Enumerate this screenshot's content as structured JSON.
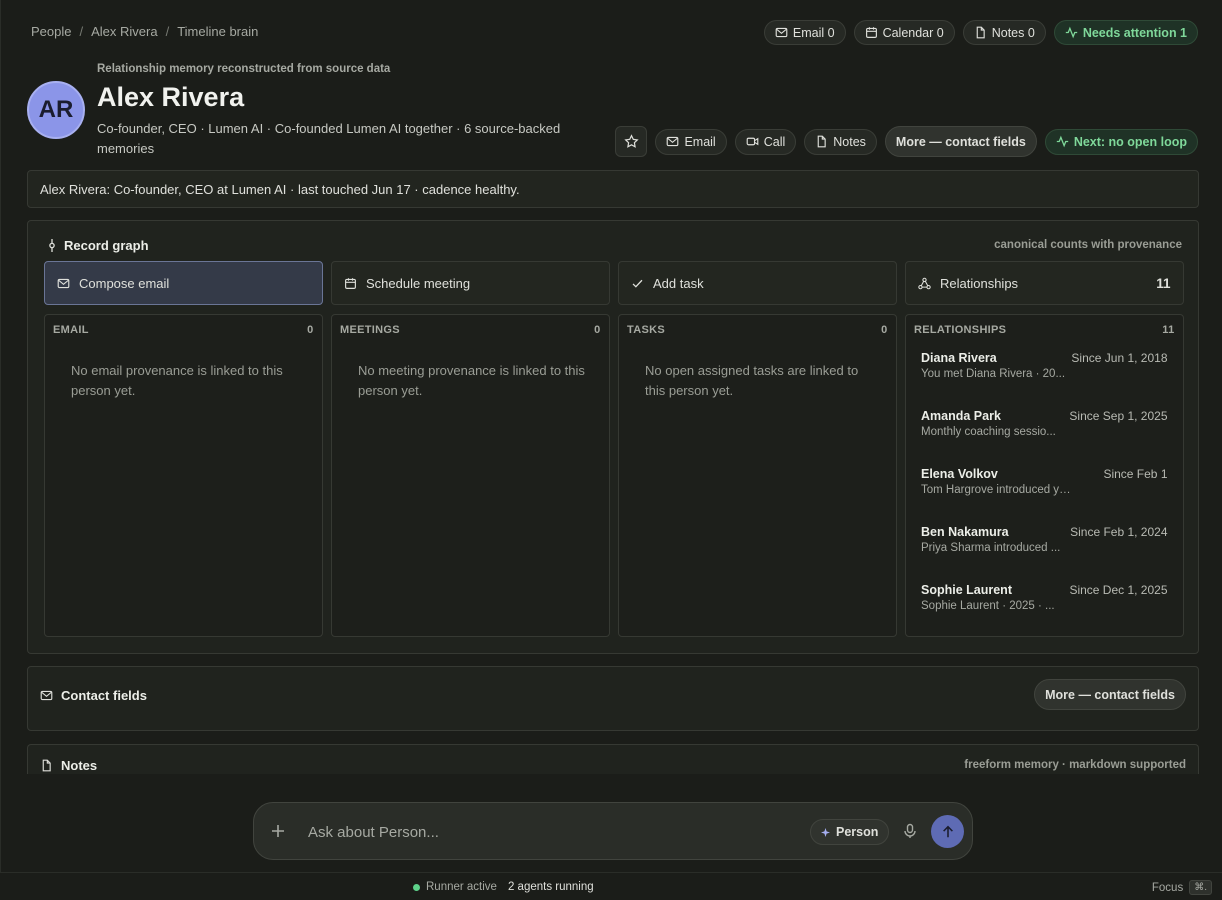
{
  "breadcrumb": [
    "People",
    "Alex Rivera",
    "Timeline brain"
  ],
  "top_chips": {
    "email": "Email 0",
    "calendar": "Calendar 0",
    "notes": "Notes 0",
    "attention": "Needs attention 1"
  },
  "header": {
    "eyebrow": "Relationship memory reconstructed from source data",
    "initials": "AR",
    "name": "Alex Rivera",
    "subtitle": "Co-founder, CEO · Lumen AI · Co-founded Lumen AI together · 6 source-backed memories"
  },
  "actions": {
    "email": "Email",
    "call": "Call",
    "notes": "Notes",
    "more_contact": "More — contact fields",
    "next": "Next: no open loop"
  },
  "summary": "Alex Rivera: Co-founder, CEO at Lumen AI · last touched Jun 17 · cadence healthy.",
  "record_graph": {
    "title": "Record graph",
    "meta": "canonical counts with provenance",
    "tiles": {
      "compose": "Compose email",
      "schedule": "Schedule meeting",
      "task": "Add task",
      "relationships": "Relationships",
      "relationships_count": "11"
    },
    "columns": {
      "email": {
        "label": "EMAIL",
        "count": "0",
        "empty": "No email provenance is linked to this person yet."
      },
      "meetings": {
        "label": "MEETINGS",
        "count": "0",
        "empty": "No meeting provenance is linked to this person yet."
      },
      "tasks": {
        "label": "TASKS",
        "count": "0",
        "empty": "No open assigned tasks are linked to this person yet."
      },
      "relationships": {
        "label": "RELATIONSHIPS",
        "count": "11",
        "items": [
          {
            "name": "Diana Rivera",
            "since": "Since Jun 1, 2018",
            "desc": "You met Diana Rivera · 20..."
          },
          {
            "name": "Amanda Park",
            "since": "Since Sep 1, 2025",
            "desc": "Monthly coaching sessio..."
          },
          {
            "name": "Elena Volkov",
            "since": "Since Feb 1",
            "desc": "Tom Hargrove introduced you t..."
          },
          {
            "name": "Ben Nakamura",
            "since": "Since Feb 1, 2024",
            "desc": "Priya Sharma introduced ..."
          },
          {
            "name": "Sophie Laurent",
            "since": "Since Dec 1, 2025",
            "desc": "Sophie Laurent · 2025 · ..."
          }
        ]
      }
    }
  },
  "contact_fields": {
    "title": "Contact fields",
    "button": "More — contact fields"
  },
  "notes_section": {
    "title": "Notes",
    "meta": "freeform memory · markdown supported"
  },
  "composer": {
    "placeholder": "Ask about Person...",
    "scope": "Person"
  },
  "status": {
    "runner": "Runner active",
    "agents": "2 agents running",
    "focus": "Focus",
    "shortcut": "⌘."
  },
  "colors": {
    "accent": "#8b95e8",
    "success": "#7fd89a",
    "send": "#5e6bb4",
    "background": "#1b1d19"
  }
}
